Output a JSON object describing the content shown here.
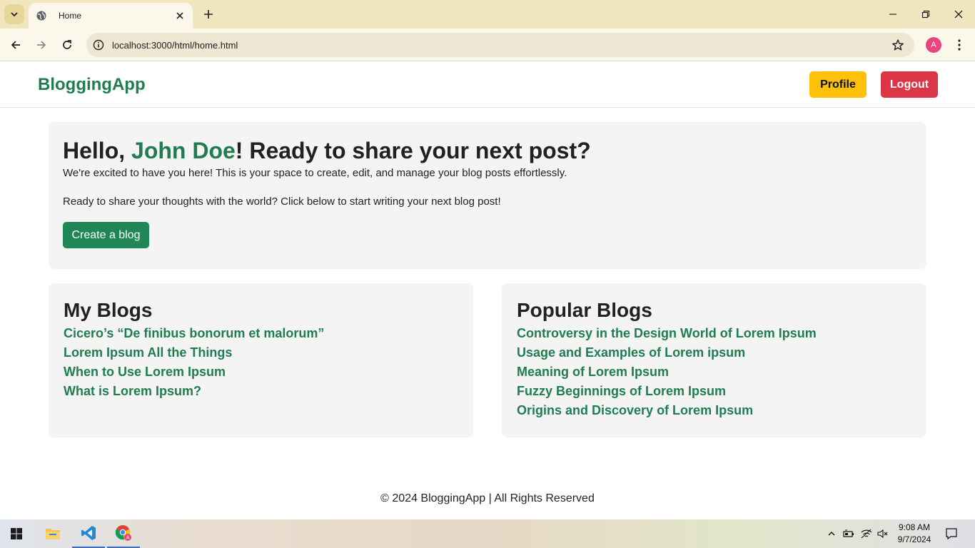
{
  "browser": {
    "tab_title": "Home",
    "url": "localhost:3000/html/home.html",
    "profile_initial": "A"
  },
  "navbar": {
    "brand": "BloggingApp",
    "profile_label": "Profile",
    "logout_label": "Logout"
  },
  "hero": {
    "greeting_prefix": "Hello, ",
    "user_name": "John Doe",
    "greeting_suffix": "! Ready to share your next post?",
    "intro": "We're excited to have you here! This is your space to create, edit, and manage your blog posts effortlessly.",
    "prompt": "Ready to share your thoughts with the world? Click below to start writing your next blog post!",
    "create_label": "Create a blog"
  },
  "my_blogs": {
    "title": "My Blogs",
    "items": [
      "Cicero’s “De finibus bonorum et malorum”",
      "Lorem Ipsum All the Things",
      "When to Use Lorem Ipsum",
      "What is Lorem Ipsum?"
    ]
  },
  "popular_blogs": {
    "title": "Popular Blogs",
    "items": [
      "Controversy in the Design World of Lorem Ipsum",
      "Usage and Examples of Lorem ipsum",
      "Meaning of Lorem Ipsum",
      "Fuzzy Beginnings of Lorem Ipsum",
      "Origins and Discovery of Lorem Ipsum"
    ]
  },
  "footer": {
    "text": "© 2024 BloggingApp | All Rights Reserved"
  },
  "taskbar": {
    "time": "9:08 AM",
    "date": "9/7/2024"
  },
  "colors": {
    "brand_green": "#1f7d50",
    "profile_yellow": "#fdc109",
    "logout_red": "#dc3545",
    "card_bg": "#f4f4f4"
  }
}
